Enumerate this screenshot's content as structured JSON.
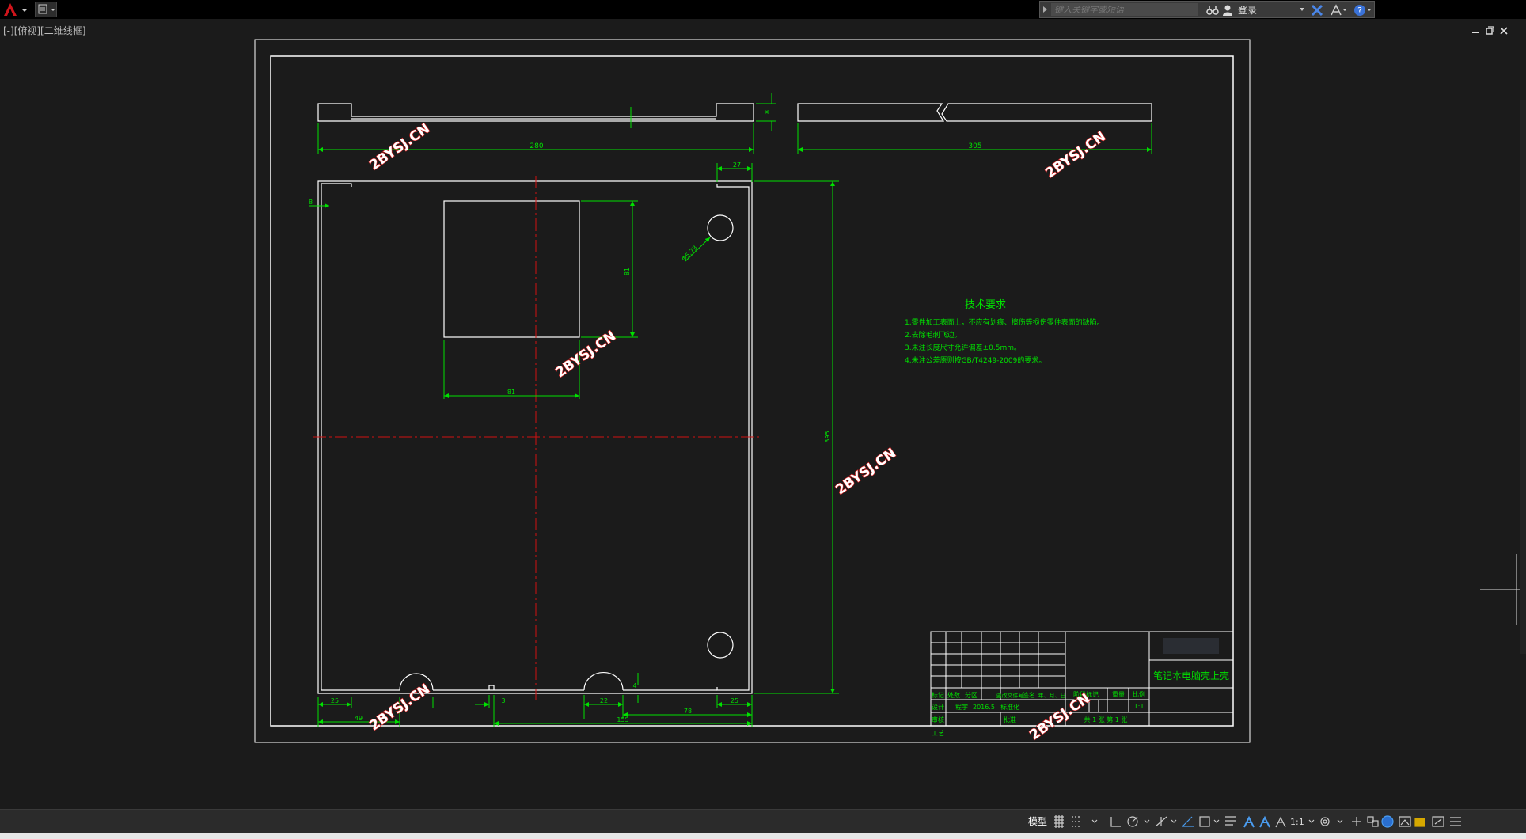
{
  "app": {
    "search_placeholder": "键入关键字或短语",
    "login_label": "登录",
    "view_label": "[-][俯视][二维线框]",
    "status_model": "模型",
    "scale": "1:1"
  },
  "drawing": {
    "top_view_dims": {
      "length": "280",
      "height": "18"
    },
    "side_view_dims": {
      "length": "305"
    },
    "main_dims": {
      "top_right": "27",
      "left_small": "8",
      "rect_height": "81",
      "rect_width": "81",
      "hole": "Φ5.73",
      "overall_height": "395",
      "b_25_left": "25",
      "b_49": "49",
      "b_3": "3",
      "b_22": "22",
      "b_4": "4",
      "b_25_right": "25",
      "b_78": "78",
      "b_155": "155"
    },
    "tech_req": {
      "title": "技术要求",
      "items": [
        "1.零件加工表面上，不应有划痕、擦伤等损伤零件表面的缺陷。",
        "2.去除毛刺飞边。",
        "3.未注长度尺寸允许偏差±0.5mm。",
        "4.未注公差原则按GB/T4249-2009的要求。"
      ]
    },
    "title_block": {
      "part_name": "笔记本电脑壳上壳",
      "row_headers": [
        "标记",
        "处数",
        "分区",
        "更改文件号",
        "签名",
        "年、月、日"
      ],
      "design_row": [
        "设计",
        "程宇",
        "2016.5",
        "标准化"
      ],
      "stage_label": "阶段标记",
      "weight_label": "重量",
      "scale_label": "比例",
      "scale_value": "1:1",
      "review": "审核",
      "process": "工艺",
      "approve": "批准",
      "sheets": "共 1 张    第 1 张"
    },
    "watermark": "2BYSJ.CN"
  },
  "colors": {
    "line": "#ffffff",
    "dim": "#00e000",
    "center": "#d01010",
    "watermark": "#e02020"
  }
}
